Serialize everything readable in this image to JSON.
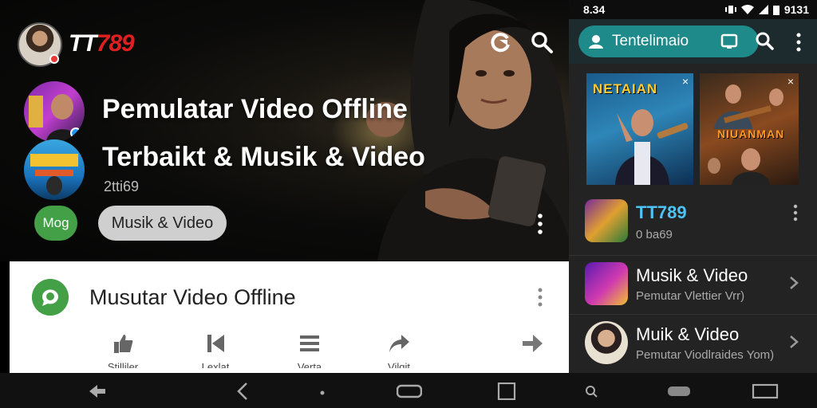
{
  "hero": {
    "brand_white": "TT",
    "brand_red": "789",
    "title_line1": "Pemulatar Video Offline",
    "title_line2": "Terbaikt  & Musik & Video",
    "subtitle": "2tti69",
    "chip_green": "Mog",
    "chip_grey": "Musik & Video"
  },
  "card": {
    "title": "Musutar Video Offline",
    "actions": [
      {
        "label": "Stilliler",
        "icon": "thumbs-up-icon"
      },
      {
        "label": "Lexlat",
        "icon": "skip-back-icon"
      },
      {
        "label": "Verta",
        "icon": "menu-lines-icon"
      },
      {
        "label": "Vilgit",
        "icon": "share-arrow-icon"
      },
      {
        "label": "",
        "icon": "forward-arrow-icon"
      }
    ]
  },
  "panel": {
    "status": {
      "time": "8.34",
      "right": "9131"
    },
    "search": {
      "label": "Tentelimaio"
    },
    "thumbs": [
      {
        "label": "NETAIAN",
        "close": "×"
      },
      {
        "label": "NIUANMAN",
        "close": "×"
      }
    ],
    "list": [
      {
        "title": "TT789",
        "subtitle": "0 ba69"
      },
      {
        "title": "Musik & Video",
        "subtitle": "Pemutar Vlettier Vrr)"
      },
      {
        "title": "Muik & Video",
        "subtitle": "Pemutar Viodlraides Yom)"
      }
    ]
  },
  "colors": {
    "accent_red": "#e02020",
    "accent_green": "#43a047",
    "teal": "#1f8a8a",
    "blue_title": "#4fc3f7"
  }
}
